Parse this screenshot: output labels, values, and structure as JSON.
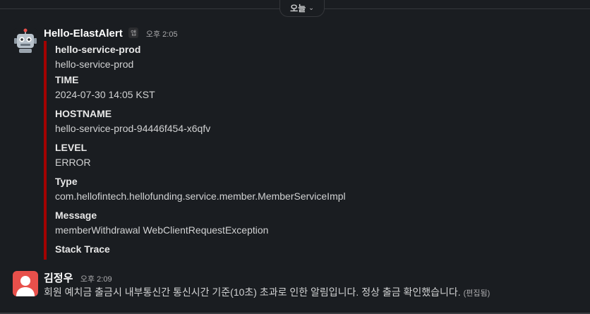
{
  "date_divider": {
    "label": "오늘"
  },
  "alert_message": {
    "sender": "Hello-ElastAlert",
    "app_badge": "앱",
    "time": "오후 2:05",
    "attachment": {
      "color": "#a30200",
      "heading": "hello-service-prod",
      "heading_value": "hello-service-prod",
      "fields": [
        {
          "title": "TIME",
          "value": "2024-07-30 14:05 KST"
        },
        {
          "title": "HOSTNAME",
          "value": "hello-service-prod-94446f454-x6qfv"
        },
        {
          "title": "LEVEL",
          "value": "ERROR"
        },
        {
          "title": "Type",
          "value": "com.hellofintech.hellofunding.service.member.MemberServiceImpl"
        },
        {
          "title": "Message",
          "value": "memberWithdrawal WebClientRequestException"
        },
        {
          "title": "Stack Trace",
          "value": ""
        }
      ]
    }
  },
  "reply_message": {
    "sender": "김정우",
    "time": "오후 2:09",
    "text": "회원 예치금 출금시 내부통신간 통신시간 기준(10초) 초과로 인한 알림입니다. 정상 출금 확인했습니다.",
    "edited_label": "(편집됨)"
  }
}
